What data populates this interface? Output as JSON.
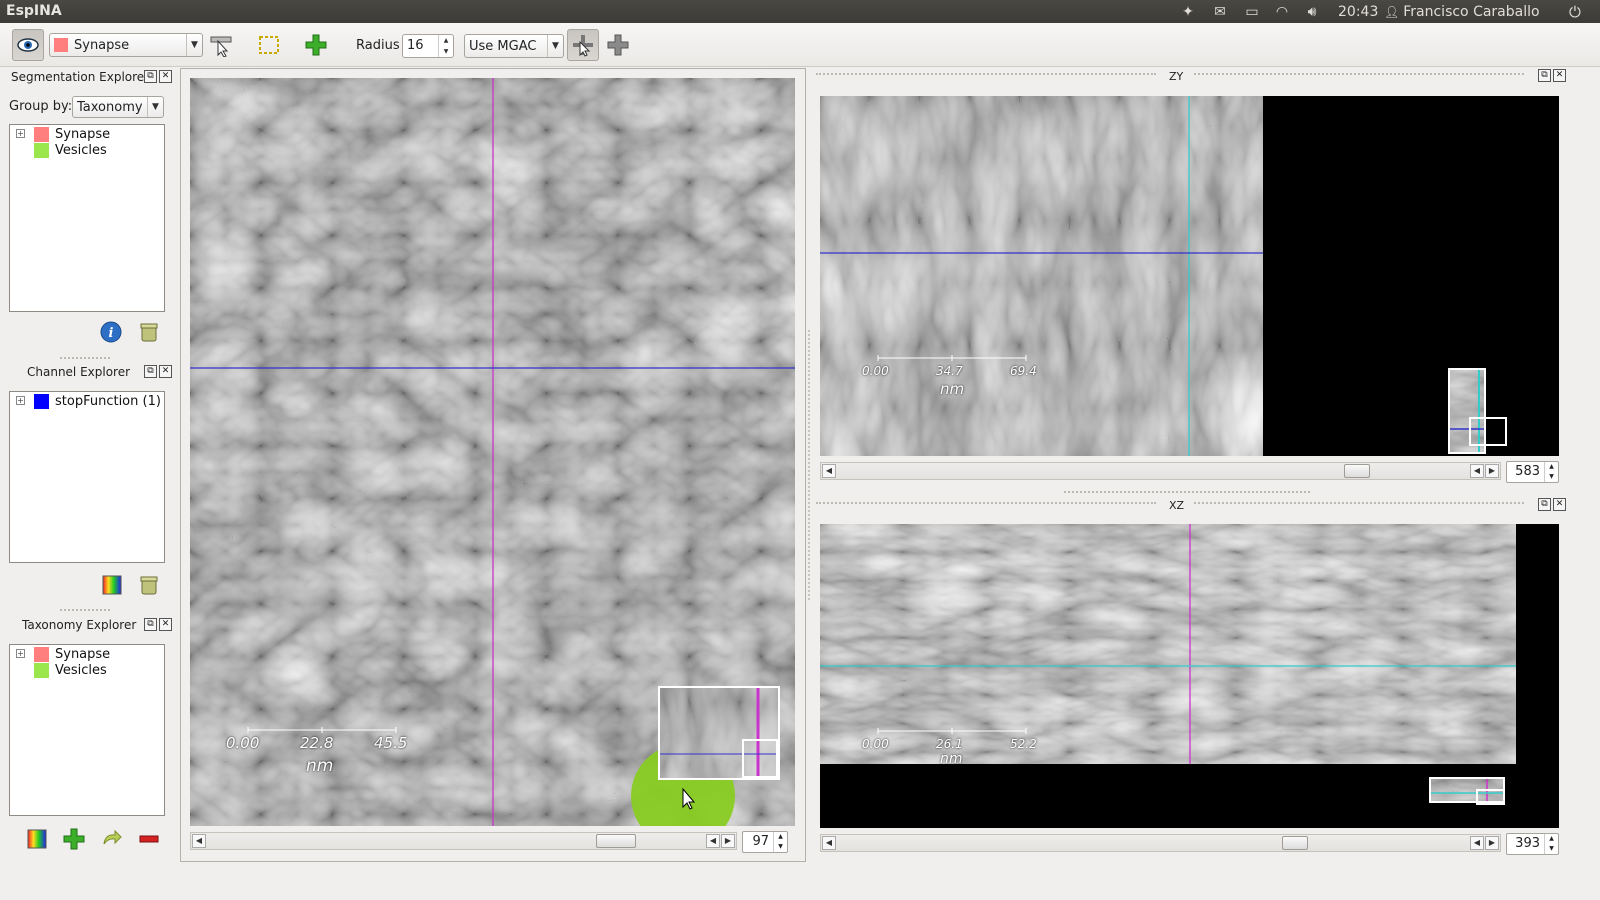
{
  "app": {
    "title": "EspINA"
  },
  "system_tray": {
    "time": "20:43",
    "user": "Francisco Caraballo",
    "icons": [
      "dropbox-icon",
      "mail-icon",
      "battery-icon",
      "wifi-icon",
      "volume-icon",
      "user-icon",
      "power-icon"
    ]
  },
  "toolbar": {
    "taxonomy_selected": "Synapse",
    "taxonomy_color": "#ff7f7f",
    "radius_label": "Radius",
    "radius_value": "16",
    "mode_selected": "Use MGAC"
  },
  "segmentation_explorer": {
    "title": "Segmentation Explorer",
    "group_by_label": "Group by:",
    "group_by_value": "Taxonomy",
    "items": [
      {
        "label": "Synapse",
        "color": "#ff7f7f"
      },
      {
        "label": "Vesicles",
        "color": "#99e64d"
      }
    ]
  },
  "channel_explorer": {
    "title": "Channel Explorer",
    "items": [
      {
        "label": "stopFunction (1)",
        "color": "#0000ff"
      }
    ]
  },
  "taxonomy_explorer": {
    "title": "Taxonomy Explorer",
    "items": [
      {
        "label": "Synapse",
        "color": "#ff7f7f"
      },
      {
        "label": "Vesicles",
        "color": "#99e64d"
      }
    ]
  },
  "views": {
    "xy": {
      "scale_labels": [
        "0.00",
        "22.8",
        "45.5"
      ],
      "unit": "nm",
      "slice": "97"
    },
    "zy": {
      "title": "ZY",
      "scale_labels": [
        "0.00",
        "34.7",
        "69.4"
      ],
      "unit": "nm",
      "slice": "583"
    },
    "xz": {
      "title": "XZ",
      "scale_labels": [
        "0.00",
        "26.1",
        "52.2"
      ],
      "unit": "nm",
      "slice": "393"
    }
  },
  "colors": {
    "crosshair_vertical_xy": "#cc33cc",
    "crosshair_horizontal_xy": "#3333cc",
    "crosshair_zy": "#33cccc",
    "brush": "#88cc22"
  }
}
